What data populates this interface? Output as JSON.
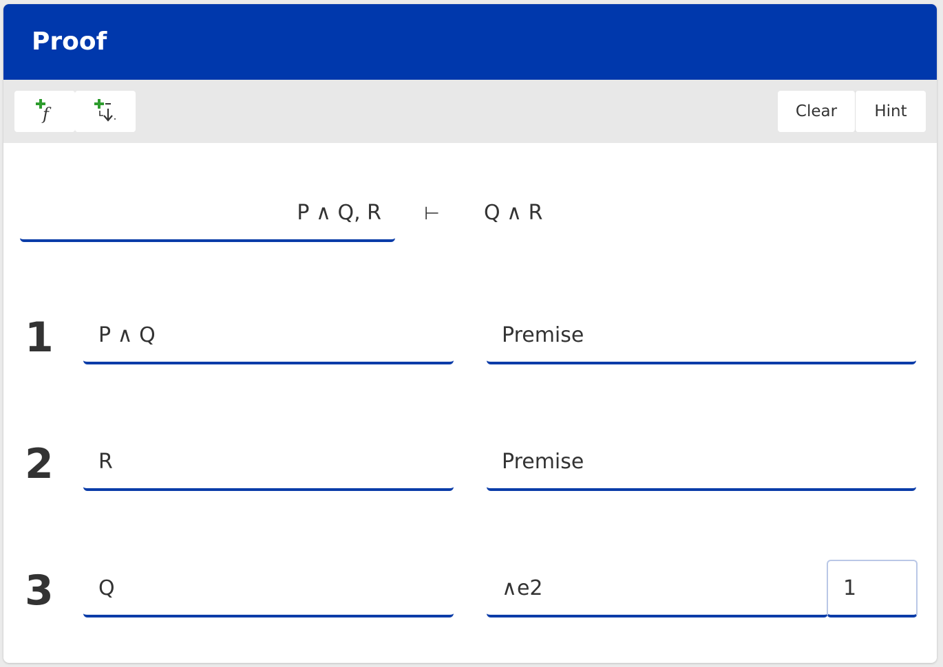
{
  "header": {
    "title": "Proof"
  },
  "toolbar": {
    "add_formula_icon": "add-formula-icon",
    "add_line_icon": "add-line-below-icon",
    "clear_label": "Clear",
    "hint_label": "Hint",
    "icon_plus_color": "#2e9c2e"
  },
  "sequent": {
    "premises": "P ∧ Q, R",
    "turnstile": "⊢",
    "conclusion": "Q ∧ R"
  },
  "lines": [
    {
      "number": "1",
      "formula": "P ∧ Q",
      "rule": "Premise",
      "refs": []
    },
    {
      "number": "2",
      "formula": "R",
      "rule": "Premise",
      "refs": []
    },
    {
      "number": "3",
      "formula": "Q",
      "rule": "∧e2",
      "refs": [
        "1"
      ]
    }
  ],
  "colors": {
    "header_bg": "#0038ac",
    "underline": "#0a3ca8",
    "toolbar_bg": "#e8e8e8"
  }
}
